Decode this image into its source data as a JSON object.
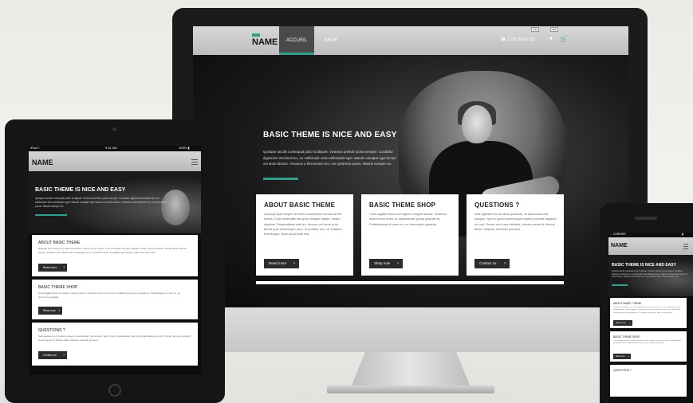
{
  "site": {
    "logo_text": "NAME",
    "nav": {
      "home": "ACCUEIL",
      "shop": "SHOP",
      "phone": "☎ 1 000 345 6789",
      "lang": [
        "FR",
        "EN"
      ]
    }
  },
  "hero": {
    "title": "BASIC THEME IS NICE AND EASY",
    "text": "Quisque iaculis consequat justo id aliquet. Vivamus pretium porta semper. Curabitur dignissim tincidunt leo, eu sollicitudin erat sollicitudin eget. Mauris volutpat eget lectus vel amet dictum. Vivamus a fermentum leo, non pharetra purus. Mauris semper eu."
  },
  "cards": [
    {
      "title": "ABOUT BASIC THEME",
      "text": "Quisque quis neque vel nulla consectetur cursus sit vel metus. Cras venenatis nisl quis tristique mattis, neque dapibus. Suspendisse nisi leo, tempor vel lacus quis. Morbi quis scelerisque arcu, id porttitor orci. Ut sodales erat augue, vitae accumsan nisl.",
      "button": "Read more"
    },
    {
      "title": "BASIC THEME SHOP",
      "text": "Cras sagittis lectus vel sapien congue lacinia. Vivamus dictum erat tortor, id ullamcorper ipsum gravida at. Pellentesque id nunc eu, eu fermentum gravida.",
      "button": "Shop now"
    },
    {
      "title": "QUESTIONS ?",
      "text": "Sed egestas leo id varius posuere, at accumsan nisl congue. Sed in quam scelerisque mauris pulvinar dapibus eu orci. Donec nec eros eleifend, viverra purus id, finibus tellus. Aliquam molestie posuere.",
      "button": "Contact us"
    }
  ],
  "ipad": {
    "status": {
      "carrier": "iPad ≡",
      "time": "9:41 AM",
      "battery": "100% ▮"
    },
    "cards": [
      {
        "title": "ABOUT BASIC THEME",
        "button": "Read more"
      },
      {
        "title": "BASIC THEME SHOP",
        "button": "Shop now"
      },
      {
        "title": "QUESTIONS ?",
        "button": "Contact us"
      }
    ]
  },
  "iphone": {
    "status": {
      "carrier": "∙∙∙ CARRIER",
      "battery": "▮"
    },
    "cards": [
      {
        "title": "ABOUT BASIC THEME",
        "button": "Read more"
      },
      {
        "title": "BASIC THEME SHOP",
        "button": "Shop now"
      },
      {
        "title": "QUESTIONS ?"
      }
    ]
  },
  "colors": {
    "accent": "#2fa08c",
    "dark": "#2c2c2c"
  }
}
